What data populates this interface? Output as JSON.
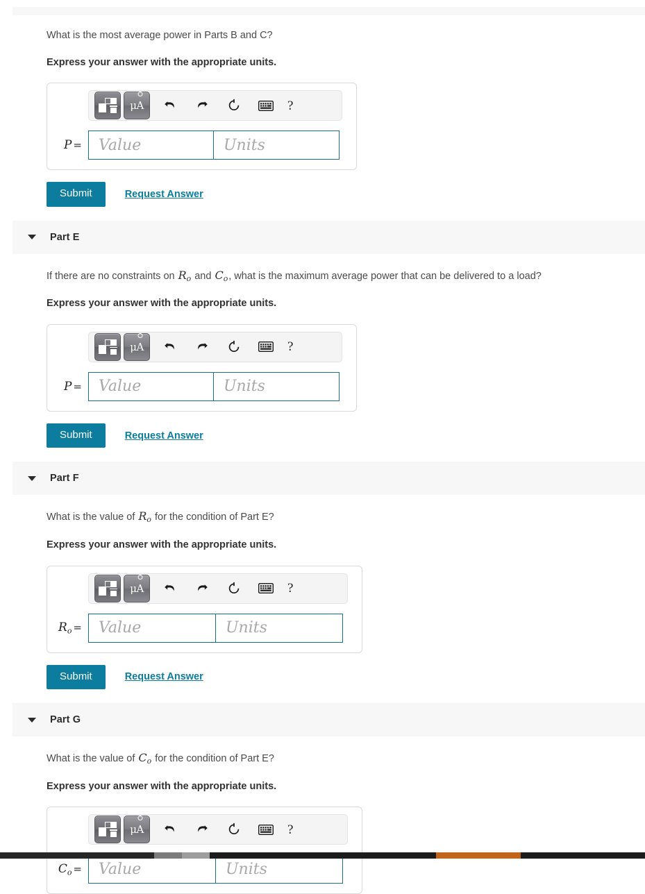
{
  "toolbar": {
    "template_button_label": "math-template",
    "units_button_label": "μÅ",
    "undo_label": "Undo",
    "redo_label": "Redo",
    "reset_label": "Reset",
    "keyboard_label": "Keyboard shortcuts",
    "help_label": "?"
  },
  "common": {
    "express_units": "Express your answer with the appropriate units.",
    "value_placeholder": "Value",
    "units_placeholder": "Units",
    "submit_label": "Submit",
    "request_answer_label": "Request Answer",
    "equals": "=",
    "caret": "▼"
  },
  "colors": {
    "accent_teal": "#0c7d9e",
    "field_border": "#1a6e8e",
    "header_band": "#f7f7f7",
    "taskbar_orange": "#c2651b",
    "taskbar_dark": "#1c1c1c"
  },
  "parts": [
    {
      "id": "part-d-tail",
      "title": null,
      "question": "What is the most average power in Parts B and C?",
      "var_symbol": "P",
      "var_sub": "",
      "box_width": "w1"
    },
    {
      "id": "part-e",
      "title": "Part E",
      "question_pre": "If there are no constraints on ",
      "question_math_1": "R",
      "question_math_1_sub": "o",
      "question_mid": " and ",
      "question_math_2": "C",
      "question_math_2_sub": "o",
      "question_post": ", what is the maximum average power that can be delivered to a load?",
      "var_symbol": "P",
      "var_sub": "",
      "box_width": "w1"
    },
    {
      "id": "part-f",
      "title": "Part F",
      "question_pre": "What is the value of ",
      "question_math_1": "R",
      "question_math_1_sub": "o",
      "question_post": " for the condition of Part E?",
      "var_symbol": "R",
      "var_sub": "o",
      "box_width": "w2"
    },
    {
      "id": "part-g",
      "title": "Part G",
      "question_pre": "What is the value of ",
      "question_math_1": "C",
      "question_math_1_sub": "o",
      "question_post": " for the condition of Part E?",
      "var_symbol": "C",
      "var_sub": "o",
      "box_width": "w2"
    }
  ]
}
